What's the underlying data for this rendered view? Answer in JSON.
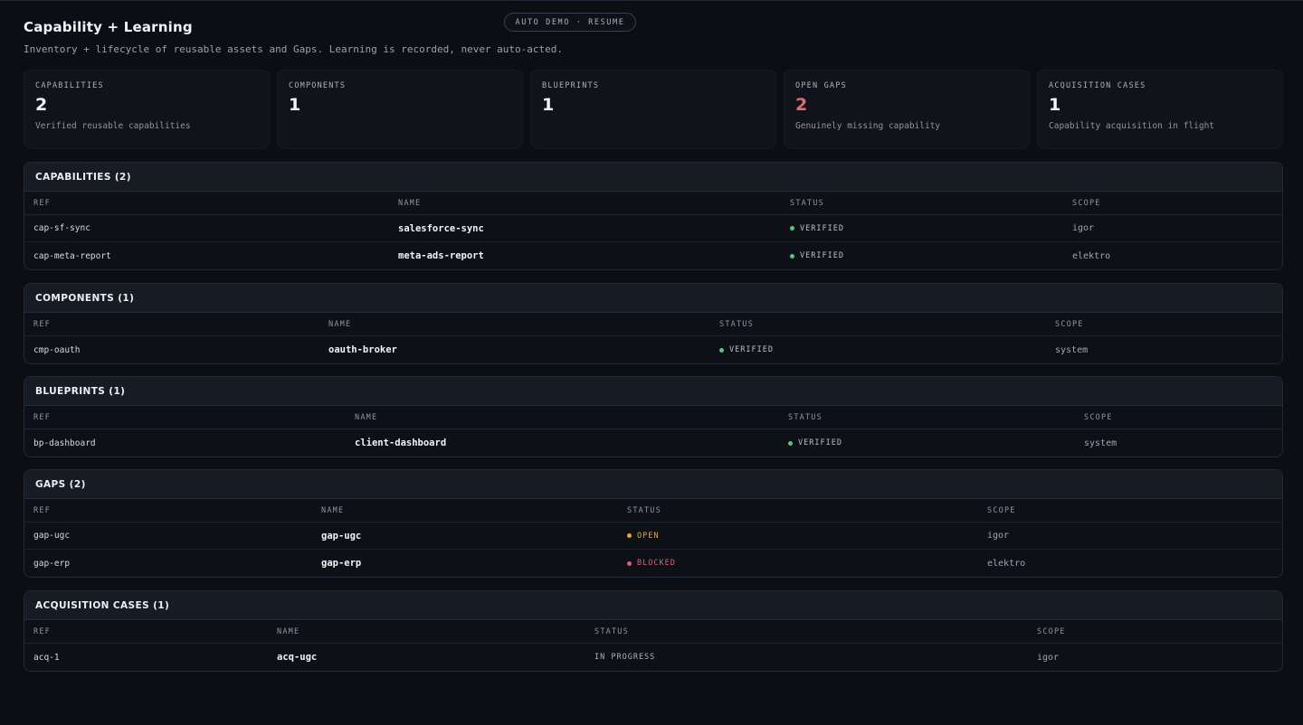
{
  "header": {
    "title": "Capability + Learning",
    "subtitle": "Inventory + lifecycle of reusable assets and Gaps. Learning is recorded, never auto-acted."
  },
  "badge": {
    "label": "AUTO DEMO · RESUME"
  },
  "stats": [
    {
      "label": "CAPABILITIES",
      "value": "2",
      "desc": "Verified reusable capabilities"
    },
    {
      "label": "COMPONENTS",
      "value": "1",
      "desc": ""
    },
    {
      "label": "BLUEPRINTS",
      "value": "1",
      "desc": ""
    },
    {
      "label": "OPEN GAPS",
      "value": "2",
      "desc": "Genuinely missing capability"
    },
    {
      "label": "ACQUISITION CASES",
      "value": "1",
      "desc": "Capability acquisition in flight"
    }
  ],
  "columns": {
    "ref": "REF",
    "name": "NAME",
    "status": "STATUS",
    "scope": "SCOPE"
  },
  "sections": {
    "capabilities": {
      "title": "CAPABILITIES (2)",
      "rows": [
        {
          "ref": "cap-sf-sync",
          "name": "salesforce-sync",
          "status": "VERIFIED",
          "scope": "igor"
        },
        {
          "ref": "cap-meta-report",
          "name": "meta-ads-report",
          "status": "VERIFIED",
          "scope": "elektro"
        }
      ]
    },
    "components": {
      "title": "COMPONENTS (1)",
      "rows": [
        {
          "ref": "cmp-oauth",
          "name": "oauth-broker",
          "status": "VERIFIED",
          "scope": "system"
        }
      ]
    },
    "blueprints": {
      "title": "BLUEPRINTS (1)",
      "rows": [
        {
          "ref": "bp-dashboard",
          "name": "client-dashboard",
          "status": "VERIFIED",
          "scope": "system"
        }
      ]
    },
    "gaps": {
      "title": "GAPS (2)",
      "rows": [
        {
          "ref": "gap-ugc",
          "name": "gap-ugc",
          "status": "OPEN",
          "scope": "igor"
        },
        {
          "ref": "gap-erp",
          "name": "gap-erp",
          "status": "BLOCKED",
          "scope": "elektro"
        }
      ]
    },
    "acquisition": {
      "title": "ACQUISITION CASES (1)",
      "rows": [
        {
          "ref": "acq-1",
          "name": "acq-ugc",
          "status": "IN PROGRESS",
          "scope": "igor"
        }
      ]
    }
  },
  "colors": {
    "verified": "#58c77d",
    "open": "#e7a63a",
    "blocked": "#e0606c",
    "open_gaps_value": "#e06b77"
  }
}
